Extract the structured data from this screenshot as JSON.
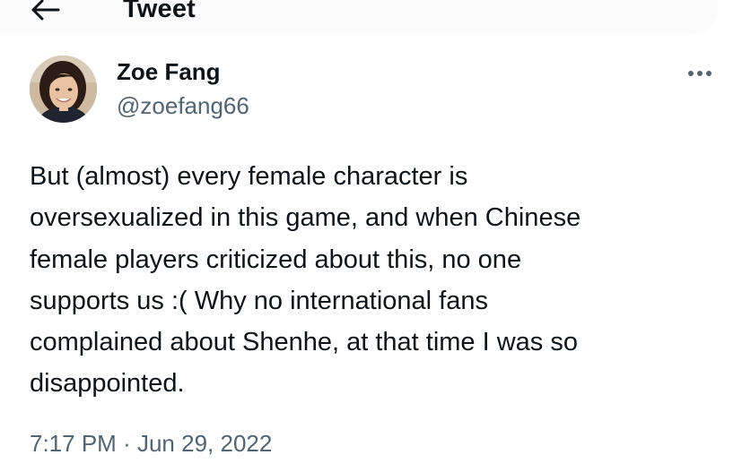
{
  "header": {
    "title": "Tweet",
    "back_icon": "arrow-left-icon"
  },
  "author": {
    "name": "Zoe Fang",
    "handle": "@zoefang66",
    "avatar_icon": "avatar-photo",
    "more_icon": "more-horizontal-icon"
  },
  "tweet": {
    "lines": [
      "But (almost) every female character is",
      "oversexualized in this game, and when Chinese",
      "female players criticized about this, no one",
      "supports us :( Why no international fans",
      "complained about Shenhe, at that time I was so",
      "disappointed."
    ],
    "time": "7:17 PM",
    "separator": "·",
    "date": "Jun 29, 2022"
  },
  "colors": {
    "text_primary": "#0f1419",
    "text_secondary": "#536471",
    "background": "#ffffff"
  }
}
